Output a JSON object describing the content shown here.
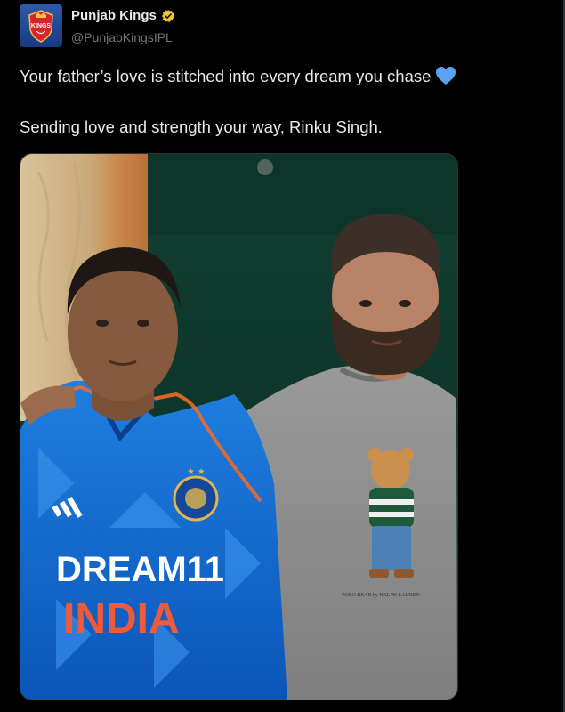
{
  "author": {
    "name": "Punjab Kings",
    "handle": "@PunjabKingsIPL",
    "verified": true,
    "avatar_icon": "punjab-kings-logo",
    "avatar_text": "KINGS"
  },
  "tweet": {
    "line1": "Your father’s love is stitched into every dream you chase",
    "line2": "Sending love and strength your way, Rinku Singh.",
    "emoji": "blue-heart-icon"
  },
  "photo": {
    "jersey_sponsor": "DREAM11",
    "jersey_country": "INDIA",
    "shirt_print": "POLO BEAR by RALPH LAUREN"
  },
  "colors": {
    "background": "#000000",
    "text": "#e7e9ea",
    "muted": "#71767b",
    "verified_badge": "#f4c430",
    "heart": "#5aa3f0"
  }
}
